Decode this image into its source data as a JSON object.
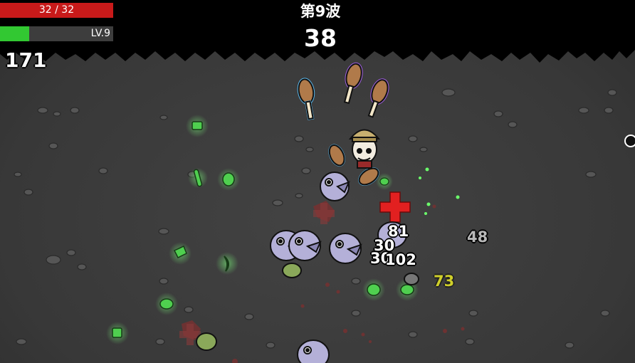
{
  "hud": {
    "health_text": "32 / 32",
    "health_fraction": 1.0,
    "level_text": "LV.9",
    "xp_fraction": 0.26,
    "materials": "171",
    "wave_label": "第9波",
    "timer": "38"
  },
  "damage_numbers": [
    {
      "text": "81",
      "style": "white"
    },
    {
      "text": "30",
      "style": "white"
    },
    {
      "text": "30",
      "style": "white"
    },
    {
      "text": "102",
      "style": "white"
    },
    {
      "text": "48",
      "style": "grey"
    },
    {
      "text": "73",
      "style": "yellow"
    }
  ],
  "colors": {
    "health": "#c81a1a",
    "xp": "#32c832",
    "background": "#3a3a3a",
    "material": "#5cd35c"
  }
}
